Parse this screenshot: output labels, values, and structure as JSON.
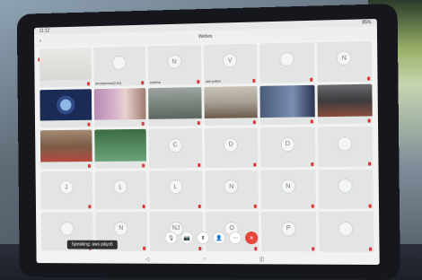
{
  "status_bar": {
    "time": "11:12",
    "right": "85%"
  },
  "meeting": {
    "title": "Webex"
  },
  "tiles": [
    {
      "name": "",
      "kind": "video",
      "video_style": "v8"
    },
    {
      "name": "anonymous(Lhc)",
      "kind": "avatar",
      "avatar": ""
    },
    {
      "name": "natcha",
      "kind": "avatar",
      "avatar": "N"
    },
    {
      "name": "nim pdkm",
      "kind": "avatar",
      "avatar": "V"
    },
    {
      "name": "",
      "kind": "avatar",
      "avatar": ""
    },
    {
      "name": "",
      "kind": "avatar",
      "avatar": "N"
    },
    {
      "name": "",
      "kind": "video",
      "video_style": "v1"
    },
    {
      "name": "",
      "kind": "video",
      "video_style": "v2"
    },
    {
      "name": "",
      "kind": "video",
      "video_style": "v3"
    },
    {
      "name": "",
      "kind": "video",
      "video_style": "v4"
    },
    {
      "name": "",
      "kind": "video",
      "video_style": "v5"
    },
    {
      "name": "",
      "kind": "video",
      "video_style": "v6"
    },
    {
      "name": "",
      "kind": "video",
      "video_style": "v7"
    },
    {
      "name": "",
      "kind": "video",
      "video_style": "v9"
    },
    {
      "name": "",
      "kind": "avatar",
      "avatar": "C"
    },
    {
      "name": "",
      "kind": "avatar",
      "avatar": "D"
    },
    {
      "name": "",
      "kind": "avatar",
      "avatar": "D"
    },
    {
      "name": "",
      "kind": "avatar",
      "avatar": ""
    },
    {
      "name": "",
      "kind": "avatar",
      "avatar": "J"
    },
    {
      "name": "",
      "kind": "avatar",
      "avatar": "L"
    },
    {
      "name": "",
      "kind": "avatar",
      "avatar": "L"
    },
    {
      "name": "",
      "kind": "avatar",
      "avatar": "N"
    },
    {
      "name": "",
      "kind": "avatar",
      "avatar": "N"
    },
    {
      "name": "",
      "kind": "avatar",
      "avatar": ""
    },
    {
      "name": "",
      "kind": "avatar",
      "avatar": ""
    },
    {
      "name": "",
      "kind": "avatar",
      "avatar": "N"
    },
    {
      "name": "",
      "kind": "avatar",
      "avatar": "NJ"
    },
    {
      "name": "",
      "kind": "avatar",
      "avatar": "O"
    },
    {
      "name": "",
      "kind": "avatar",
      "avatar": "P"
    },
    {
      "name": "",
      "kind": "avatar",
      "avatar": ""
    }
  ],
  "toolbar": {
    "buttons": [
      {
        "icon": "mute-icon",
        "glyph": "🎙"
      },
      {
        "icon": "camera-icon",
        "glyph": "📷"
      },
      {
        "icon": "share-icon",
        "glyph": "⬆"
      },
      {
        "icon": "participants-icon",
        "glyph": "👤"
      },
      {
        "icon": "more-icon",
        "glyph": "⋯"
      },
      {
        "icon": "end-call-icon",
        "glyph": "✕",
        "end": true
      }
    ]
  },
  "speaking_label": "Speaking: aws p&yc6",
  "navbar": {
    "back": "◁",
    "home": "○",
    "recents": "|||"
  }
}
